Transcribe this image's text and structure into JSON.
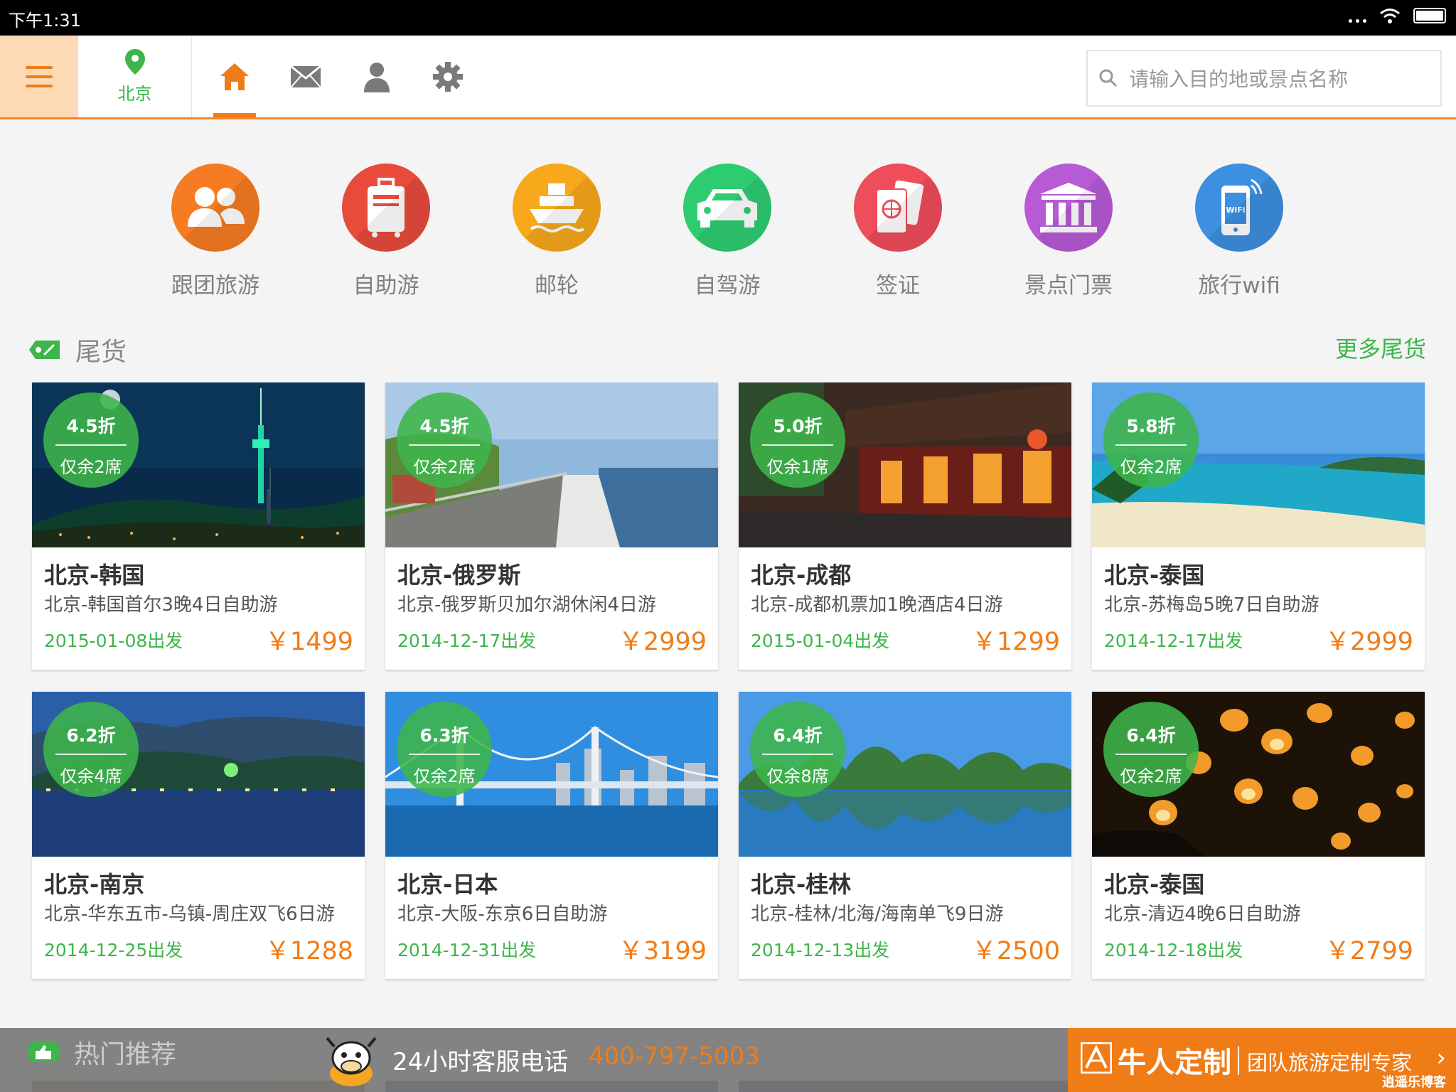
{
  "status_bar": {
    "time": "下午1:31"
  },
  "header": {
    "city": "北京",
    "search_placeholder": "请输入目的地或景点名称",
    "tabs": [
      "home-icon",
      "mail-icon",
      "user-icon",
      "settings-icon"
    ],
    "active_tab": "home-icon"
  },
  "categories": [
    {
      "label": "跟团旅游",
      "color": "#f57c22",
      "icon": "group-icon"
    },
    {
      "label": "自助游",
      "color": "#e84b3c",
      "icon": "luggage-icon"
    },
    {
      "label": "邮轮",
      "color": "#f7a81b",
      "icon": "ship-icon"
    },
    {
      "label": "自驾游",
      "color": "#2ecc71",
      "icon": "car-icon"
    },
    {
      "label": "签证",
      "color": "#ee4d5a",
      "icon": "passport-icon"
    },
    {
      "label": "景点门票",
      "color": "#b65ad6",
      "icon": "temple-icon"
    },
    {
      "label": "旅行wifi",
      "color": "#3d8fe0",
      "icon": "wifi-phone-icon"
    }
  ],
  "deals_section": {
    "title": "尾货",
    "more": "更多尾货"
  },
  "deals": [
    {
      "discount": "4.5折",
      "seats": "仅余2席",
      "title": "北京-韩国",
      "subtitle": "北京-韩国首尔3晚4日自助游",
      "date": "2015-01-08出发",
      "price": "￥1499",
      "scene": "seoul-night"
    },
    {
      "discount": "4.5折",
      "seats": "仅余2席",
      "title": "北京-俄罗斯",
      "subtitle": "北京-俄罗斯贝加尔湖休闲4日游",
      "date": "2014-12-17出发",
      "price": "￥2999",
      "scene": "coast-road"
    },
    {
      "discount": "5.0折",
      "seats": "仅余1席",
      "title": "北京-成都",
      "subtitle": "北京-成都机票加1晚酒店4日游",
      "date": "2015-01-04出发",
      "price": "￥1299",
      "scene": "old-street"
    },
    {
      "discount": "5.8折",
      "seats": "仅余2席",
      "title": "北京-泰国",
      "subtitle": "北京-苏梅岛5晚7日自助游",
      "date": "2014-12-17出发",
      "price": "￥2999",
      "scene": "beach"
    },
    {
      "discount": "6.2折",
      "seats": "仅余4席",
      "title": "北京-南京",
      "subtitle": "北京-华东五市-乌镇-周庄双飞6日游",
      "date": "2014-12-25出发",
      "price": "￥1288",
      "scene": "lake-night"
    },
    {
      "discount": "6.3折",
      "seats": "仅余2席",
      "title": "北京-日本",
      "subtitle": "北京-大阪-东京6日自助游",
      "date": "2014-12-31出发",
      "price": "￥3199",
      "scene": "bridge"
    },
    {
      "discount": "6.4折",
      "seats": "仅余8席",
      "title": "北京-桂林",
      "subtitle": "北京-桂林/北海/海南单飞9日游",
      "date": "2014-12-13出发",
      "price": "￥2500",
      "scene": "karst"
    },
    {
      "discount": "6.4折",
      "seats": "仅余2席",
      "title": "北京-泰国",
      "subtitle": "北京-清迈4晚6日自助游",
      "date": "2014-12-18出发",
      "price": "￥2799",
      "scene": "lanterns"
    }
  ],
  "hot_section": {
    "title": "热门推荐"
  },
  "banner": {
    "service_label": "24小时客服电话",
    "phone": "400-797-5003",
    "brand": "牛人定制",
    "slogan": "团队旅游定制专家",
    "watermark": "逍遥乐博客"
  },
  "colors": {
    "accent": "#f07c18",
    "green": "#3db54a"
  }
}
